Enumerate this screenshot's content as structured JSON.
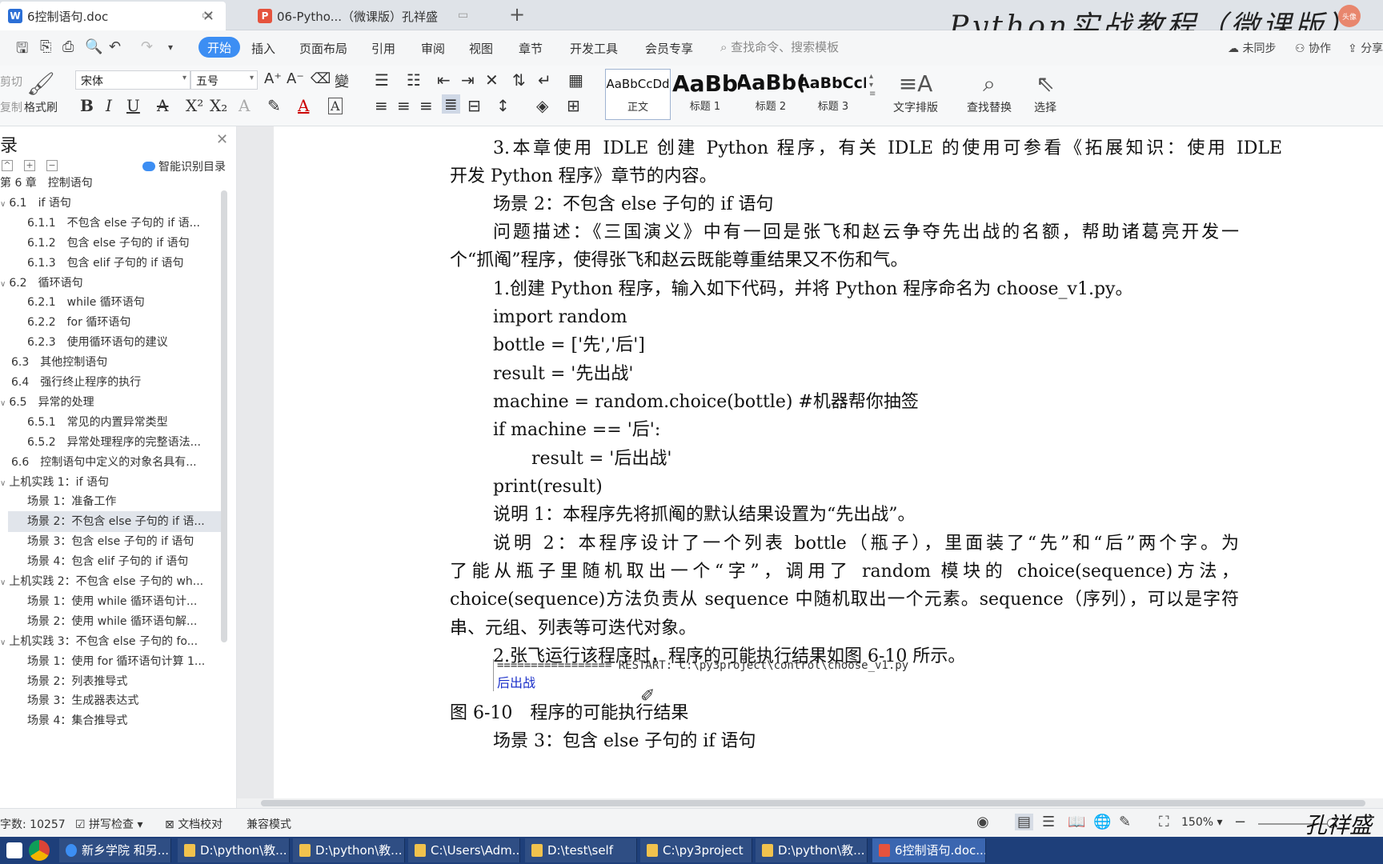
{
  "tabs": [
    {
      "label": "6控制语句.doc",
      "icon": "W"
    },
    {
      "label": "06-Pytho...（微课版）孔祥盛",
      "icon": "P"
    }
  ],
  "watermark": "Python实战教程（微课版）",
  "avatar_text": "头像",
  "menu": {
    "start": "开始",
    "items": [
      "插入",
      "页面布局",
      "引用",
      "审阅",
      "视图",
      "章节",
      "开发工具",
      "会员专享"
    ],
    "search_placeholder": "查找命令、搜索模板",
    "sync": "未同步",
    "collab": "协作",
    "share": "分享"
  },
  "ribbon": {
    "cut": "剪切",
    "copy": "复制",
    "format_painter": "格式刷",
    "font_name": "宋体",
    "font_size": "五号",
    "styles": [
      {
        "sample": "AaBbCcDd",
        "name": "正文"
      },
      {
        "sample": "AaBb",
        "name": "标题 1"
      },
      {
        "sample": "AaBb(",
        "name": "标题 2"
      },
      {
        "sample": "AaBbCcI",
        "name": "标题 3"
      }
    ],
    "text_layout": "文字排版",
    "find_replace": "查找替换",
    "select": "选择"
  },
  "sidebar": {
    "title": "录",
    "smart_toc": "智能识别目录",
    "items": [
      {
        "label": "第 6 章　控制语句",
        "level": 0,
        "arrow": false
      },
      {
        "label": "6.1　if 语句",
        "level": 1,
        "arrow": true
      },
      {
        "label": "6.1.1　不包含 else 子句的 if 语...",
        "level": 2,
        "arrow": false
      },
      {
        "label": "6.1.2　包含 else 子句的 if 语句",
        "level": 2,
        "arrow": false
      },
      {
        "label": "6.1.3　包含 elif 子句的 if 语句",
        "level": 2,
        "arrow": false
      },
      {
        "label": "6.2　循环语句",
        "level": 1,
        "arrow": true
      },
      {
        "label": "6.2.1　while 循环语句",
        "level": 2,
        "arrow": false
      },
      {
        "label": "6.2.2　for 循环语句",
        "level": 2,
        "arrow": false
      },
      {
        "label": "6.2.3　使用循环语句的建议",
        "level": 2,
        "arrow": false
      },
      {
        "label": "6.3　其他控制语句",
        "level": 1,
        "arrow": false
      },
      {
        "label": "6.4　强行终止程序的执行",
        "level": 1,
        "arrow": false
      },
      {
        "label": "6.5　异常的处理",
        "level": 1,
        "arrow": true
      },
      {
        "label": "6.5.1　常见的内置异常类型",
        "level": 2,
        "arrow": false
      },
      {
        "label": "6.5.2　异常处理程序的完整语法...",
        "level": 2,
        "arrow": false
      },
      {
        "label": "6.6　控制语句中定义的对象名具有...",
        "level": 1,
        "arrow": false
      },
      {
        "label": "上机实践 1：if 语句",
        "level": 1,
        "arrow": true
      },
      {
        "label": "场景 1：准备工作",
        "level": 2,
        "arrow": false
      },
      {
        "label": "场景 2：不包含 else 子句的 if 语...",
        "level": 2,
        "arrow": false,
        "selected": true
      },
      {
        "label": "场景 3：包含 else 子句的 if 语句",
        "level": 2,
        "arrow": false
      },
      {
        "label": "场景 4：包含 elif 子句的 if 语句",
        "level": 2,
        "arrow": false
      },
      {
        "label": "上机实践 2：不包含 else 子句的 wh...",
        "level": 1,
        "arrow": true
      },
      {
        "label": "场景 1：使用 while 循环语句计...",
        "level": 2,
        "arrow": false
      },
      {
        "label": "场景 2：使用 while 循环语句解...",
        "level": 2,
        "arrow": false
      },
      {
        "label": "上机实践 3：不包含 else 子句的 fo...",
        "level": 1,
        "arrow": true
      },
      {
        "label": "场景 1：使用 for 循环语句计算 1...",
        "level": 2,
        "arrow": false
      },
      {
        "label": "场景 2：列表推导式",
        "level": 2,
        "arrow": false
      },
      {
        "label": "场景 3：生成器表达式",
        "level": 2,
        "arrow": false
      },
      {
        "label": "场景 4：集合推导式",
        "level": 2,
        "arrow": false
      }
    ]
  },
  "document": {
    "lines": [
      "3.本章使用 IDLE 创建 Python 程序，有关 IDLE 的使用可参看《拓展知识：使用 IDLE",
      "开发 Python 程序》章节的内容。",
      "场景 2：不包含 else 子句的 if 语句",
      "问题描述：《三国演义》中有一回是张飞和赵云争夺先出战的名额，帮助诸葛亮开发一",
      "个“抓阄”程序，使得张飞和赵云既能尊重结果又不伤和气。",
      "1.创建 Python 程序，输入如下代码，并将 Python 程序命名为 choose_v1.py。",
      "import random",
      "bottle = ['先','后']",
      "result = '先出战'",
      "machine = random.choice(bottle) #机器帮你抽签",
      "if machine == '后':",
      "result = '后出战'",
      "print(result)",
      "说明 1：本程序先将抓阄的默认结果设置为“先出战”。",
      "说明 2：本程序设计了一个列表 bottle（瓶子），里面装了“先”和“后”两个字。为",
      "了能从瓶子里随机取出一个“字”，调用了 random 模块的 choice(sequence)方法，",
      "choice(sequence)方法负责从 sequence 中随机取出一个元素。sequence（序列），可以是字符",
      "串、元组、列表等可迭代对象。",
      "2.张飞运行该程序时，程序的可能执行结果如图 6-10 所示。"
    ],
    "code_restart": "================= RESTART: C:\\py3project\\control\\choose_v1.py",
    "code_output": "后出战",
    "figure_caption": "图 6-10　程序的可能执行结果",
    "next_heading": "场景 3：包含 else 子句的 if 语句"
  },
  "status": {
    "word_count": "字数: 10257",
    "spell_check": "拼写检查",
    "doc_proof": "文档校对",
    "compat_mode": "兼容模式",
    "zoom": "150%"
  },
  "taskbar": [
    {
      "label": "新乡学院 和另...",
      "kind": "app"
    },
    {
      "label": "D:\\python\\教...",
      "kind": "folder"
    },
    {
      "label": "D:\\python\\教...",
      "kind": "folder"
    },
    {
      "label": "C:\\Users\\Adm...",
      "kind": "folder"
    },
    {
      "label": "D:\\test\\self",
      "kind": "folder"
    },
    {
      "label": "C:\\py3project",
      "kind": "folder"
    },
    {
      "label": "D:\\python\\教...",
      "kind": "folder"
    },
    {
      "label": "6控制语句.doc...",
      "kind": "wps",
      "active": true
    }
  ],
  "handwriting": "孔祥盛"
}
